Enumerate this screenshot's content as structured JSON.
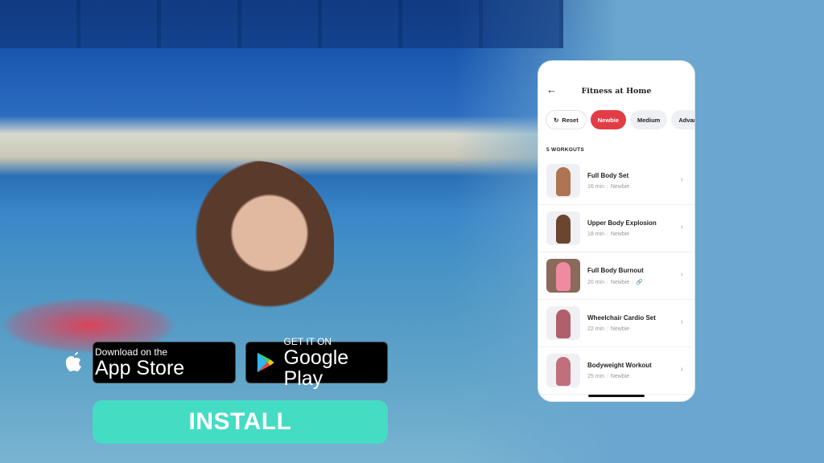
{
  "ad": {
    "app_store": {
      "small": "Download on the",
      "big": "App Store"
    },
    "google_play": {
      "small": "GET IT ON",
      "big": "Google Play"
    },
    "install_label": "INSTALL",
    "colors": {
      "install": "#45dcc4",
      "active_chip": "#e23c45"
    }
  },
  "phone": {
    "back_icon": "←",
    "title": "Fitness at Home",
    "filters": [
      {
        "label": "Reset",
        "icon": "refresh-icon"
      },
      {
        "label": "Newbie",
        "active": true
      },
      {
        "label": "Medium"
      },
      {
        "label": "Advance"
      }
    ],
    "count": "5 WORKOUTS",
    "workouts": [
      {
        "name": "Full Body Set",
        "duration": "16 min",
        "level": "Newbie"
      },
      {
        "name": "Upper Body Explosion",
        "duration": "18 min",
        "level": "Newbie"
      },
      {
        "name": "Full Body Burnout",
        "duration": "20 min",
        "level": "Newbie",
        "extra_icon": "link-icon"
      },
      {
        "name": "Wheelchair Cardio Set",
        "duration": "22 min",
        "level": "Newbie"
      },
      {
        "name": "Bodyweight Workout",
        "duration": "25 min",
        "level": "Newbie"
      }
    ]
  }
}
